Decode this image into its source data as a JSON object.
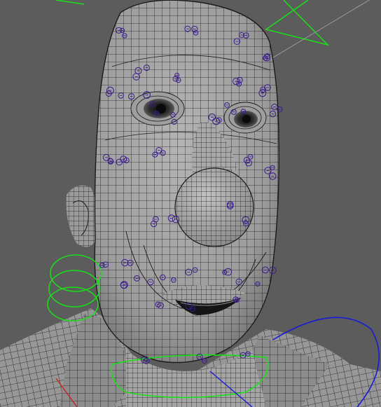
{
  "viewport": {
    "background_color": "#5c5c5c",
    "mesh_fill_color": "#a6a6a6",
    "mesh_wire_color": "#1b1b1b",
    "rig_control_green": "#18e018",
    "rig_control_blue": "#1a1ad6",
    "rig_control_red": "#cc2020",
    "cluster_handle_color": "#3a1a8c",
    "cluster_handle_count": 95
  }
}
